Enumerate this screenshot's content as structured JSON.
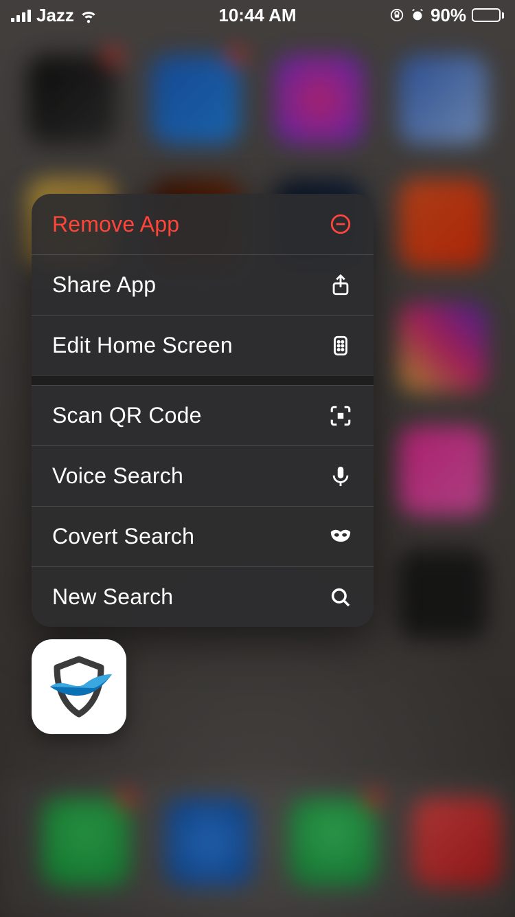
{
  "status_bar": {
    "carrier": "Jazz",
    "time": "10:44 AM",
    "battery_percent": "90%",
    "battery_fill_pct": 90
  },
  "context_menu": {
    "group1": [
      {
        "label": "Remove App",
        "icon": "minus-circle-icon",
        "destructive": true
      },
      {
        "label": "Share App",
        "icon": "share-icon"
      },
      {
        "label": "Edit Home Screen",
        "icon": "apps-grid-icon"
      }
    ],
    "group2": [
      {
        "label": "Scan QR Code",
        "icon": "qr-scan-icon"
      },
      {
        "label": "Voice Search",
        "icon": "microphone-icon"
      },
      {
        "label": "Covert Search",
        "icon": "mask-icon"
      },
      {
        "label": "New Search",
        "icon": "search-icon"
      }
    ]
  },
  "focused_app": {
    "name": "security-app-icon"
  },
  "colors": {
    "destructive": "#ff453a",
    "menu_bg": "rgba(45,45,47,0.92)"
  }
}
